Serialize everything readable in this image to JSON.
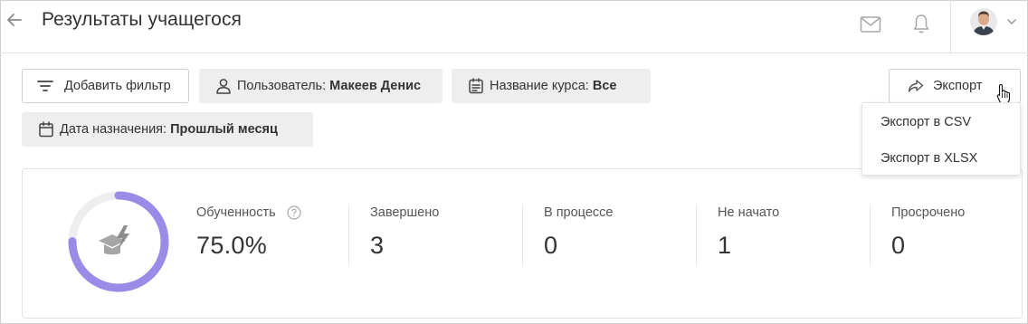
{
  "header": {
    "title": "Результаты учащегося"
  },
  "filters": {
    "add_filter_label": "Добавить фильтр",
    "user_label": "Пользователь:",
    "user_value": "Макеев Денис",
    "course_label": "Название курса:",
    "course_value": "Все",
    "date_label": "Дата назначения:",
    "date_value": "Прошлый месяц"
  },
  "export": {
    "label": "Экспорт",
    "menu": [
      {
        "label": "Экспорт в CSV"
      },
      {
        "label": "Экспорт в XLSX"
      }
    ]
  },
  "stats": {
    "progress_fraction": 0.75,
    "items": [
      {
        "label": "Обученность",
        "value": "75.0%"
      },
      {
        "label": "Завершено",
        "value": "3"
      },
      {
        "label": "В процессе",
        "value": "0"
      },
      {
        "label": "Не начато",
        "value": "1"
      },
      {
        "label": "Просрочено",
        "value": "0"
      }
    ]
  },
  "colors": {
    "accent": "#9b8ae6",
    "track": "#eeeeee",
    "icon_gray": "#9e9e9e"
  },
  "icons": {
    "back": "arrow-left-icon",
    "mail": "mail-icon",
    "bell": "bell-icon",
    "filter": "filter-lines-icon",
    "user": "user-icon",
    "course": "clipboard-icon",
    "calendar": "calendar-icon",
    "export": "share-arrow-icon",
    "help": "question-circle-icon",
    "donut_center": "graduation-cap-bolt-icon"
  }
}
